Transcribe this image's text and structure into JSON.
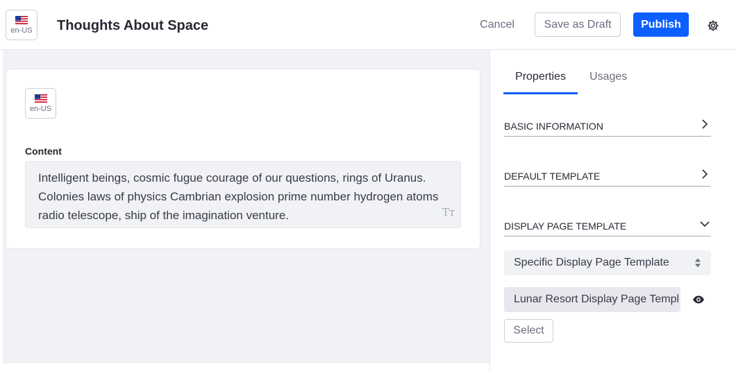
{
  "header": {
    "locale_code": "en-US",
    "title": "Thoughts About Space",
    "cancel_label": "Cancel",
    "draft_label": "Save as Draft",
    "publish_label": "Publish"
  },
  "content": {
    "locale_code": "en-US",
    "label": "Content",
    "text": "Intelligent beings, cosmic fugue courage of our questions, rings of Uranus. Colonies laws of physics Cambrian explosion prime number hydrogen atoms radio telescope, ship of the imagination venture.",
    "format_icon": "Tт"
  },
  "sidebar": {
    "tabs": [
      {
        "label": "Properties",
        "active": true
      },
      {
        "label": "Usages",
        "active": false
      }
    ],
    "sections": [
      {
        "label": "BASIC INFORMATION",
        "state": "collapsed"
      },
      {
        "label": "DEFAULT TEMPLATE",
        "state": "collapsed"
      },
      {
        "label": "DISPLAY PAGE TEMPLATE",
        "state": "expanded"
      }
    ],
    "display_page_select": "Specific Display Page Template",
    "template_value": "Lunar Resort Display Page Templ",
    "select_label": "Select"
  },
  "colors": {
    "primary": "#0b5fff",
    "text": "#272833",
    "muted": "#6b6c7e",
    "background": "#f1f2f5"
  }
}
